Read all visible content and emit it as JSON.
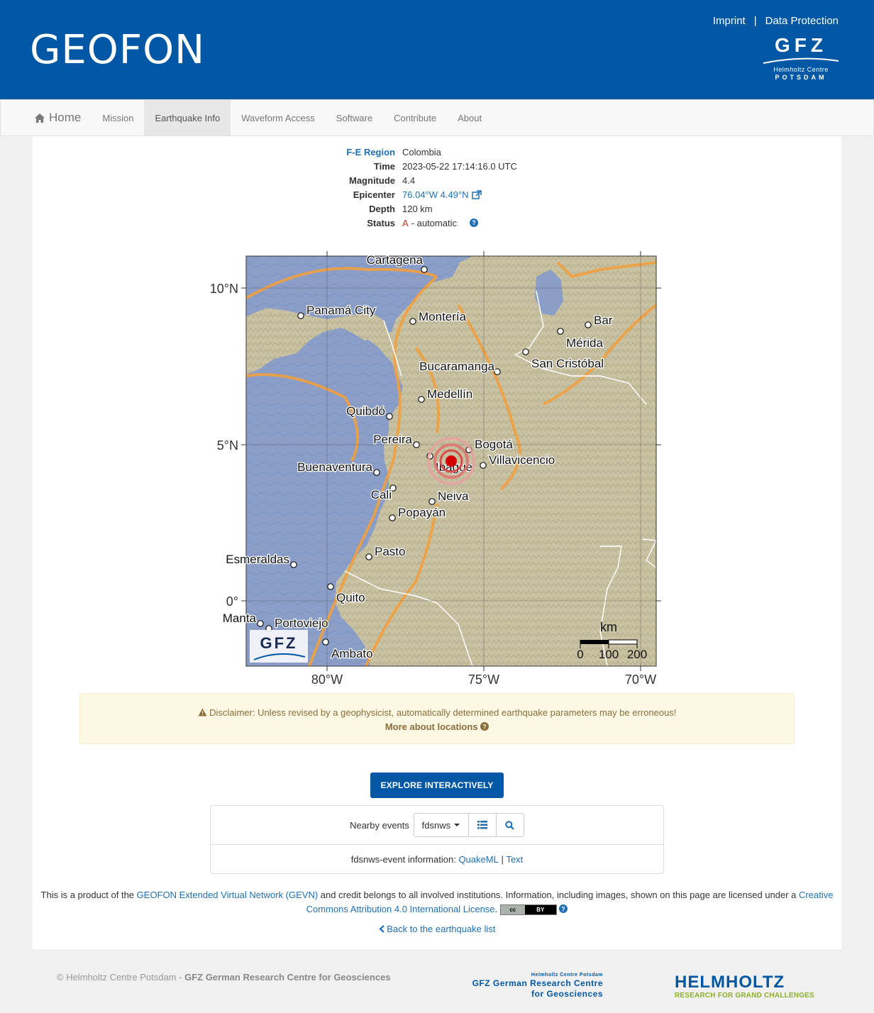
{
  "header": {
    "site_title": "GEOFON",
    "imprint": "Imprint",
    "separator": "|",
    "data_protection": "Data Protection",
    "logo_main": "GFZ",
    "logo_sub1": "Helmholtz Centre",
    "logo_sub2": "POTSDAM"
  },
  "nav": {
    "home": "Home",
    "items": [
      "Mission",
      "Earthquake Info",
      "Waveform Access",
      "Software",
      "Contribute",
      "About"
    ],
    "active": "Earthquake Info"
  },
  "event": {
    "region_label": "F-E Region",
    "region": "Colombia",
    "time_label": "Time",
    "time": "2023-05-22 17:14:16.0 UTC",
    "magnitude_label": "Magnitude",
    "magnitude": "4.4",
    "epicenter_label": "Epicenter",
    "epicenter": "76.04°W 4.49°N",
    "depth_label": "Depth",
    "depth": "120 km",
    "status_label": "Status",
    "status_code": "A",
    "status_text": " - automatic"
  },
  "map": {
    "lat_labels": [
      "10°N",
      "5°N",
      "0°"
    ],
    "lon_labels": [
      "80°W",
      "75°W",
      "70°W"
    ],
    "scale_unit": "km",
    "scale_ticks": [
      "0",
      "100",
      "200"
    ],
    "logo": "GFZ",
    "cities": [
      {
        "name": "Cartagena"
      },
      {
        "name": "Panamá City"
      },
      {
        "name": "Montería"
      },
      {
        "name": "Bar"
      },
      {
        "name": "Mérida"
      },
      {
        "name": "San Cristóbal"
      },
      {
        "name": "Bucaramanga"
      },
      {
        "name": "Medellín"
      },
      {
        "name": "Quibdó"
      },
      {
        "name": "Pereira"
      },
      {
        "name": "Bogotá"
      },
      {
        "name": "Villavicencio"
      },
      {
        "name": "Ibague"
      },
      {
        "name": "Buenaventura"
      },
      {
        "name": "Cali"
      },
      {
        "name": "Neiva"
      },
      {
        "name": "Popayán"
      },
      {
        "name": "Pasto"
      },
      {
        "name": "Esmeraldas"
      },
      {
        "name": "Quito"
      },
      {
        "name": "Manta"
      },
      {
        "name": "Portoviejo"
      },
      {
        "name": "Ambato"
      }
    ],
    "colors": {
      "ocean": "#8a9ec8",
      "land": "#c9c2a2",
      "plate_boundary": "#f0a040",
      "epicenter": "#d40000"
    }
  },
  "disclaimer": {
    "text": "Disclaimer: Unless revised by a geophysicist, automatically determined earthquake parameters may be erroneous!",
    "more": "More about locations"
  },
  "explore_button": "EXPLORE INTERACTIVELY",
  "nearby": {
    "label": "Nearby events",
    "service": "fdsnws",
    "info_label": "fdsnws-event information:",
    "quakeml": "QuakeML",
    "sep": "|",
    "text": "Text"
  },
  "footer": {
    "product_prefix": "This is a product of the ",
    "gevn": "GEOFON Extended Virtual Network (GEVN)",
    "product_mid": " and credit belongs to all involved institutions. Information, including images, shown on this page are licensed under a ",
    "license": "Creative Commons Attribution 4.0 International License",
    "cc_left": "cc",
    "cc_right": "BY",
    "back": "Back to the earthquake list",
    "copyright_prefix": "© Helmholtz Centre Potsdam - ",
    "copyright_bold": "GFZ German Research Centre for Geosciences",
    "gfz_foot_small": "Helmholtz Centre Potsdam",
    "gfz_foot_line1": "GFZ German Research Centre",
    "gfz_foot_line2": "for Geosciences",
    "helmholtz": "HELMHOLTZ",
    "helmholtz_tag": "RESEARCH FOR GRAND CHALLENGES"
  }
}
